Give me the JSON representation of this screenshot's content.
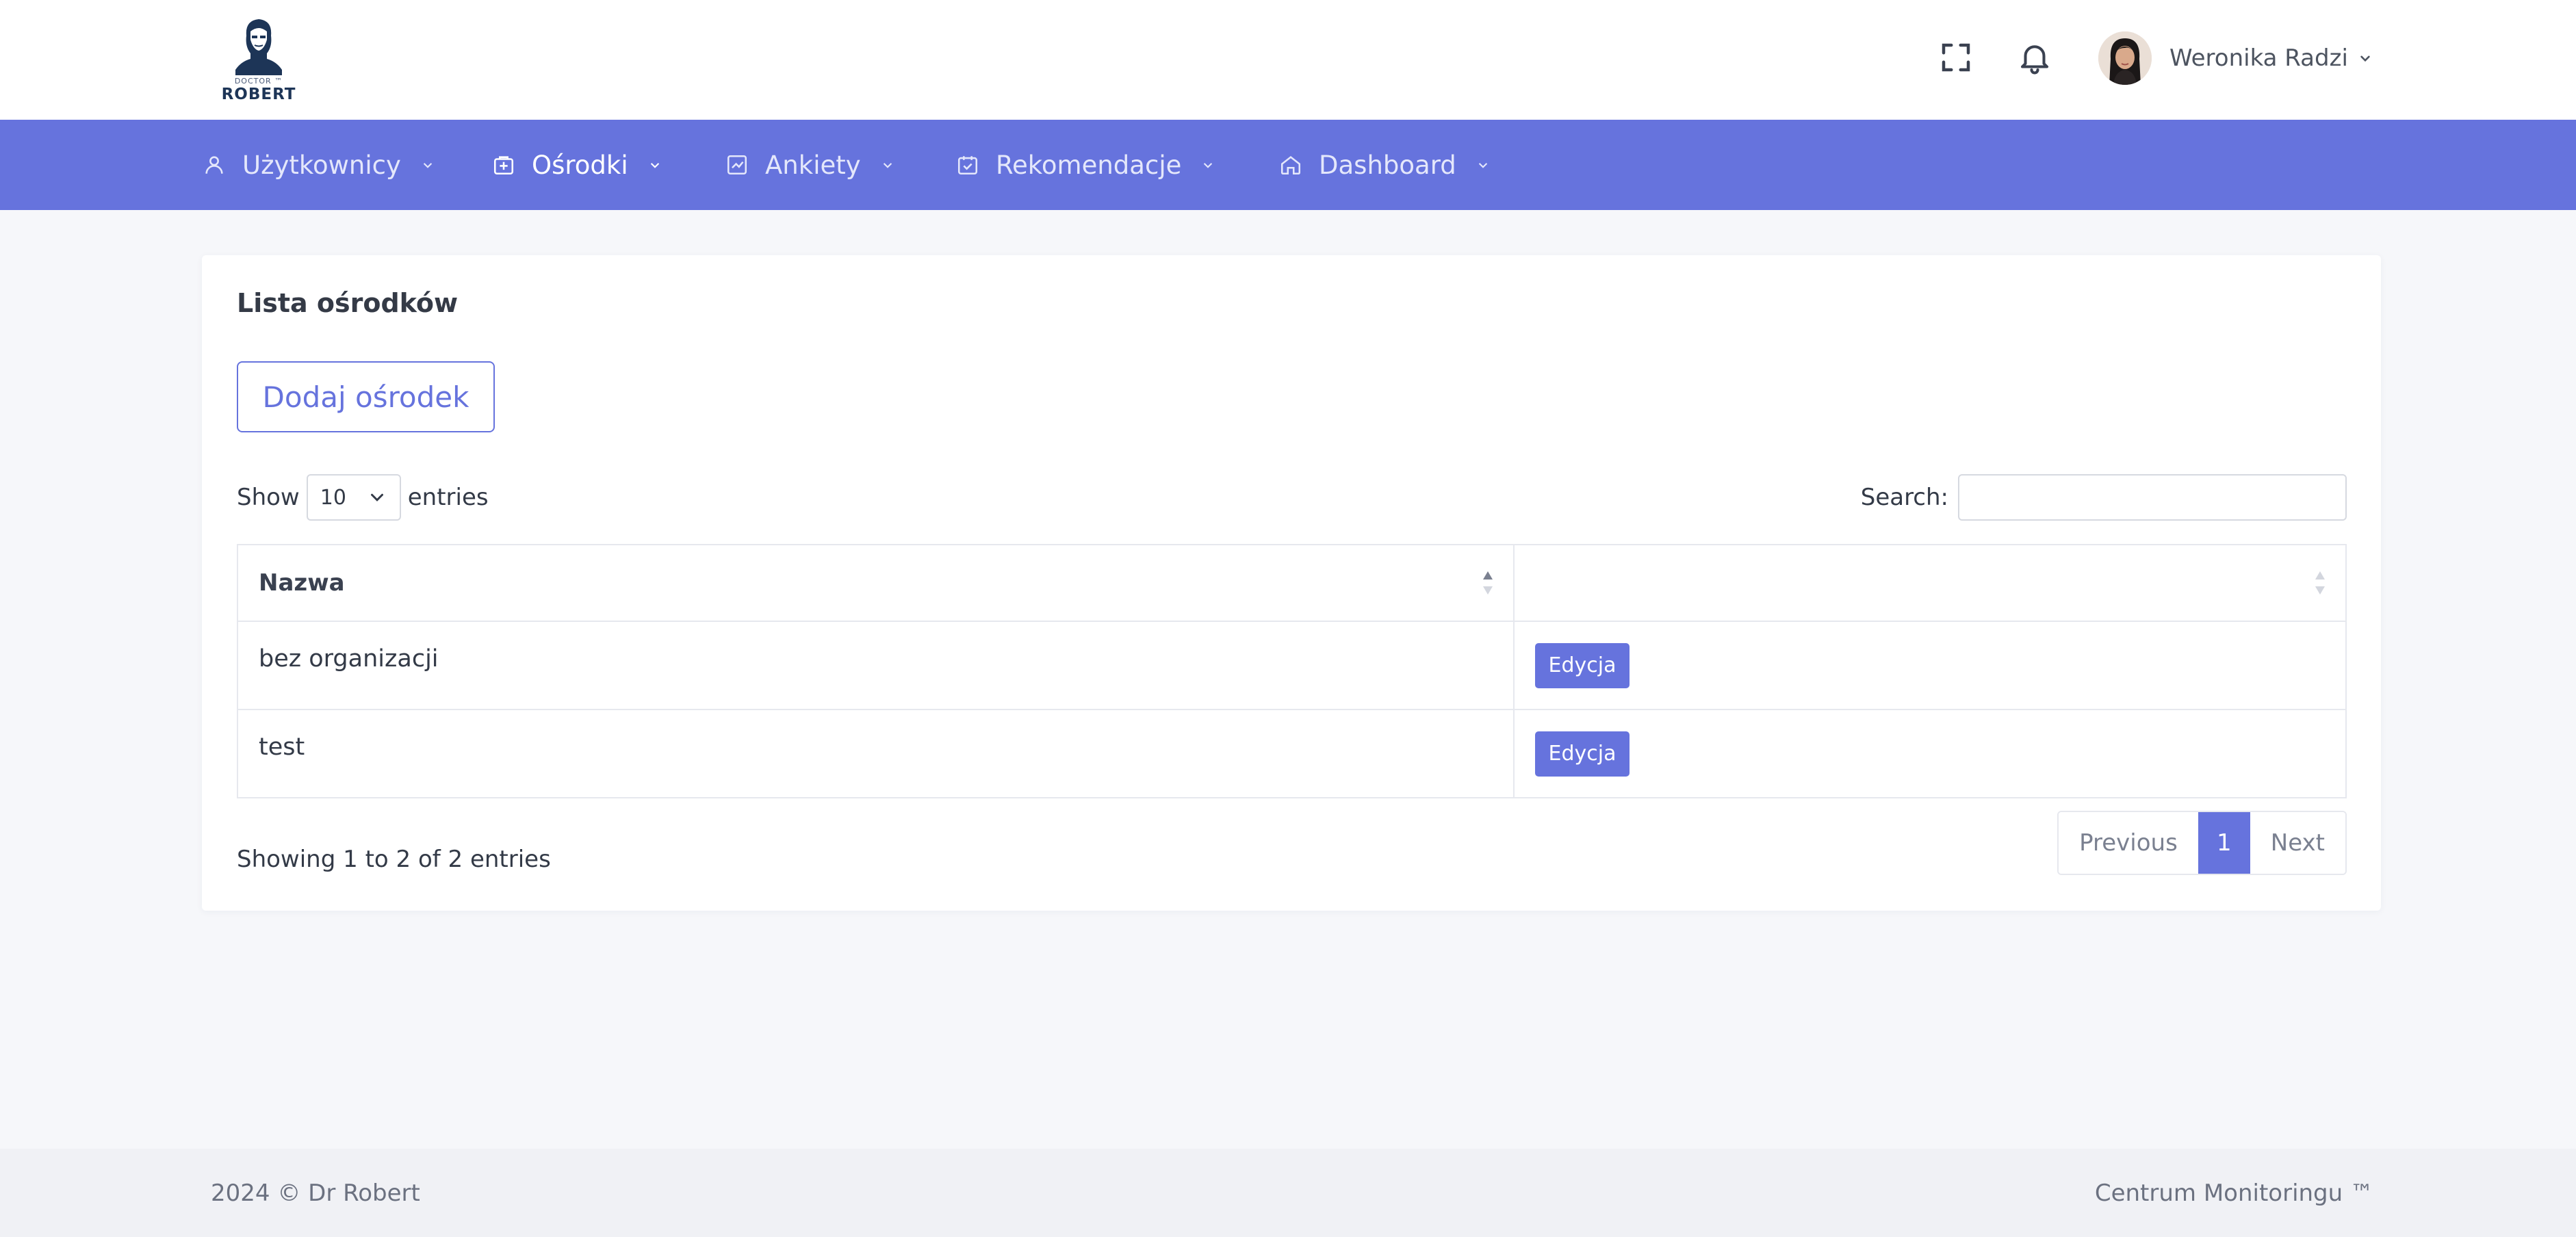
{
  "brand": {
    "logo_small": "DOCTOR ™",
    "logo_big": "ROBERT"
  },
  "header": {
    "fullscreen_icon": "fullscreen-icon",
    "notification_icon": "bell-icon",
    "user_name": "Weronika Radzi"
  },
  "nav": {
    "items": [
      {
        "label": "Użytkownicy",
        "icon": "user-icon"
      },
      {
        "label": "Ośrodki",
        "icon": "building-icon",
        "active": true
      },
      {
        "label": "Ankiety",
        "icon": "chart-square-icon"
      },
      {
        "label": "Rekomendacje",
        "icon": "calendar-check-icon"
      },
      {
        "label": "Dashboard",
        "icon": "home-icon"
      }
    ]
  },
  "card": {
    "title": "Lista ośrodków",
    "add_button": "Dodaj ośrodek",
    "show_label": "Show",
    "entries_label": "entries",
    "page_length": "10",
    "search_label": "Search:",
    "search_value": ""
  },
  "table": {
    "columns": [
      "Nazwa",
      ""
    ],
    "rows": [
      {
        "name": "bez organizacji",
        "action": "Edycja"
      },
      {
        "name": "test",
        "action": "Edycja"
      }
    ]
  },
  "pagination": {
    "info": "Showing 1 to 2 of 2 entries",
    "previous": "Previous",
    "current": "1",
    "next": "Next"
  },
  "footer": {
    "left": "2024 © Dr Robert",
    "right": "Centrum Monitoringu ™"
  },
  "colors": {
    "accent": "#6673dd",
    "nav_bg": "#6673dd",
    "page_bg": "#f6f7fa"
  }
}
